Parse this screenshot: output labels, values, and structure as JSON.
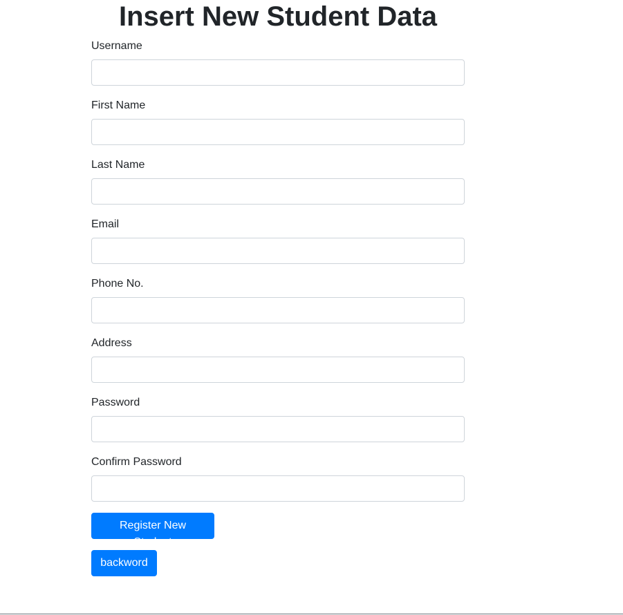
{
  "page": {
    "title": "Insert New Student Data"
  },
  "form": {
    "fields": [
      {
        "label": "Username",
        "value": "",
        "placeholder": ""
      },
      {
        "label": "First Name",
        "value": "",
        "placeholder": ""
      },
      {
        "label": "Last Name",
        "value": "",
        "placeholder": ""
      },
      {
        "label": "Email",
        "value": "",
        "placeholder": ""
      },
      {
        "label": "Phone No.",
        "value": "",
        "placeholder": ""
      },
      {
        "label": "Address",
        "value": "",
        "placeholder": ""
      },
      {
        "label": "Password",
        "value": "",
        "placeholder": ""
      },
      {
        "label": "Confirm Password",
        "value": "",
        "placeholder": ""
      }
    ],
    "register_label": "Register New Student",
    "back_label": "backword"
  },
  "colors": {
    "primary": "#007bff",
    "text": "#212529",
    "border": "#ced4da"
  }
}
